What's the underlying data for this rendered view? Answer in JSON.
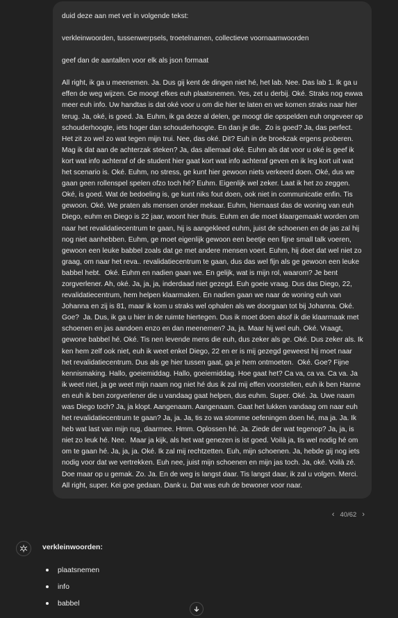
{
  "user_message": {
    "paragraphs": [
      "duid deze aan met vet in volgende tekst:",
      "verkleinwoorden, tussenwerpsels, troetelnamen, collectieve voornaamwoorden",
      "geef dan de aantallen voor elk als json formaat",
      "All right, ik ga u meenemen. Ja. Dus gij kent de dingen niet hé, het lab. Nee. Das lab 1. Ik ga u effen de weg wijzen. Ge moogt efkes euh plaatsnemen. Yes, zet u derbij. Oké. Straks nog ewwa meer euh info. Uw handtas is dat oké voor u om die hier te laten en we komen straks naar hier terug. Ja, oké, is goed. Ja. Euhm, ik ga deze al delen, ge moogt die opspelden euh ongeveer op schouderhoogte, iets hoger dan schouderhoogte. En dan je die.  Zo is goed? Ja, das perfect. Het zit zo wel zo wat tegen mijn trui. Nee, das oké. Dit? Euh in de broekzak ergens proberen. Mag ik dat aan de achterzak steken? Ja, das allemaal oké. Euhm als dat voor u oké is geef ik kort wat info achteraf of de student hier gaat kort wat info achteraf geven en ik leg kort uit wat het scenario is. Oké. Euhm, no stress, ge kunt hier gewoon niets verkeerd doen. Oké, dus we gaan geen rollenspel spelen ofzo toch hé? Euhm. Eigenlijk wel zeker. Laat ik het zo zeggen. Oké, is goed. Wat de bedoeling is, ge kunt niks fout doen, ook niet in communicatie enfin. Tis gewoon. Oké. We praten als mensen onder mekaar. Euhm, hiernaast das de woning van euh Diego, euhm en Diego is 22 jaar, woont hier thuis. Euhm en die moet klaargemaakt worden om naar het revalidatiecentrum te gaan, hij is aangekleed euhm, juist de schoenen en de jas zal hij nog niet aanhebben. Euhm, ge moet eigenlijk gewoon een beetje een fijne small talk voeren, gewoon een leuke babbel zoals dat ge met andere mensen voert. Euhm, hij doet dat wel niet zo graag, om naar het reva.. revalidatiecentrum te gaan, dus das wel fijn als ge gewoon een leuke babbel hebt.  Oké. Euhm en nadien gaan we. En gelijk, wat is mijn rol, waarom? Je bent zorgverlener. Ah, oké. Ja, ja, ja, inderdaad niet gezegd. Euh goeie vraag. Dus das Diego, 22, revalidatiecentrum, hem helpen klaarmaken. En nadien gaan we naar de woning euh van Johanna en zij is 81, maar ik kom u straks wel ophalen als we doorgaan tot bij Johanna. Oké. Goe?  Ja. Dus, ik ga u hier in de ruimte hiertegen. Dus ik moet doen alsof ik die klaarmaak met schoenen en jas aandoen enzo en dan meenemen? Ja, ja. Maar hij wel euh. Oké. Vraagt, gewone babbel hé. Oké. Tis nen levende mens die euh, dus zeker als ge. Oké. Dus zeker als. Ik ken hem zelf ook niet, euh ik weet enkel Diego, 22 en er is mij gezegd geweest hij moet naar het revalidatiecentrum. Dus als ge hier tussen gaat, ga je hem ontmoeten.  Oké. Goe? Fijne kennismaking. Hallo, goeiemiddag. Hallo, goeiemiddag. Hoe gaat het? Ca va, ca va. Ca va. Ja ik weet niet, ja ge weet mijn naam nog niet hé dus ik zal mij effen voorstellen, euh ik ben Hanne en euh ik ben zorgverlener die u vandaag gaat helpen, dus euhm. Super. Oké. Ja. Uwe naam was Diego toch? Ja, ja klopt. Aangenaam. Aangenaam. Gaat het lukken vandaag om naar euh het revalidatiecentrum te gaan? Ja, ja. Ja, tis zo wa stomme oefeningen doen hé, ma ja. Ja. Ik heb wat last van mijn rug, daarmee. Hmm. Oplossen hé. Ja. Ziede der wat tegenop? Ja, ja, is niet zo leuk hé. Nee.  Maar ja kijk, als het wat genezen is ist goed. Voilà ja, tis wel nodig hé om om te gaan hé. Ja, ja, ja. Oké. Ik zal mij rechtzetten. Euh, mijn schoenen. Ja, hebde gij nog iets nodig voor dat we vertrekken. Euh nee, juist mijn schoenen en mijn jas toch. Ja, oké. Voilà zé. Doe maar op u gemak. Zo. Ja. En de weg is langst daar. Tis langst daar, ik zal u volgen. Merci. All right, super. Kei goe gedaan. Dank u. Dat was euh de bewoner voor naar."
    ]
  },
  "pager": {
    "label": "40/62",
    "prev_icon": "chevron-left-icon",
    "next_icon": "chevron-right-icon"
  },
  "assistant": {
    "icon": "openai-logo-icon",
    "heading": "verkleinwoorden:",
    "items": [
      "plaatsnemen",
      "info",
      "babbel"
    ]
  },
  "scroll_button": {
    "icon": "arrow-down-icon"
  },
  "colors": {
    "background": "#212121",
    "bubble": "#2f2f2f",
    "text": "#ececec",
    "muted": "#b4b4b4"
  }
}
